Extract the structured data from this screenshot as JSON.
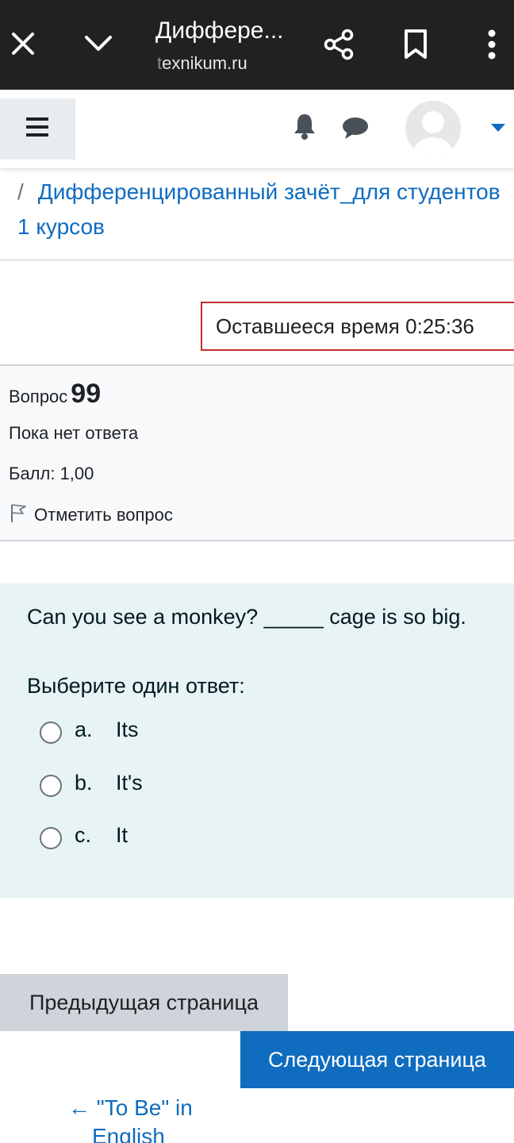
{
  "browser": {
    "title": "Диффере...",
    "url_prefix": "t",
    "url_rest": "exnikum.ru",
    "icons": [
      "close-icon",
      "chevron-down-icon",
      "share-icon",
      "bookmark-icon",
      "more-vert-icon"
    ]
  },
  "navbar": {
    "icons": [
      "hamburger-icon",
      "bell-icon",
      "chat-icon",
      "avatar",
      "caret-down-icon"
    ]
  },
  "breadcrumb": {
    "separator": "/",
    "link": "Дифференцированный зачёт_для студентов 1 курсов"
  },
  "timer": {
    "label": "Оставшееся время",
    "value": "0:25:36"
  },
  "question": {
    "label": "Вопрос",
    "number": "99",
    "state": "Пока нет ответа",
    "grade": "Балл: 1,00",
    "flag": "Отметить вопрос",
    "text": "Can you see a monkey? _____ cage is so big.",
    "prompt": "Выберите один ответ:",
    "answers": [
      {
        "letter": "a.",
        "text": "Its"
      },
      {
        "letter": "b.",
        "text": "It's"
      },
      {
        "letter": "c.",
        "text": "It"
      }
    ]
  },
  "navigation": {
    "prev_button": "Предыдущая страница",
    "next_button": "Следующая страница",
    "prev_activity_line1": "← \"To Be\" in",
    "prev_activity_line2": "English"
  },
  "colors": {
    "link": "#0f6cbf",
    "timer_border": "#c4312b",
    "formulation_bg": "#e7f3f5",
    "chrome_bg": "#212121"
  }
}
